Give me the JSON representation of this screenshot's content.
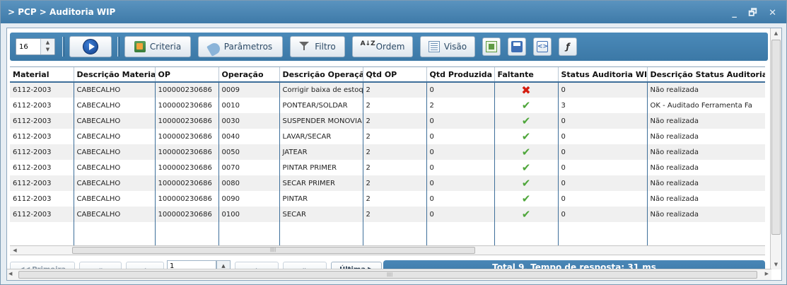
{
  "window": {
    "title": "> PCP > Auditoria WIP",
    "controls": "_ 🗗 ✕"
  },
  "toolbar": {
    "rows_per_page": "16",
    "buttons": {
      "criteria": "Criteria",
      "parametros": "Parâmetros",
      "filtro": "Filtro",
      "ordem": "Ordem",
      "visao": "Visão"
    },
    "ordem_icon_text": "A↓Z"
  },
  "table": {
    "columns": [
      "Material",
      "Descrição Material",
      "OP",
      "Operação",
      "Descrição Operação",
      "Qtd OP",
      "Qtd Produzida",
      "Faltante",
      "Status Auditoria WIP",
      "Descrição Status Auditoria"
    ],
    "rows": [
      {
        "material": "6112-2003",
        "descricao_material": "CABECALHO",
        "op": "100000230686",
        "operacao": "0009",
        "descricao_operacao": "Corrigir baixa de estoque",
        "qtd_op": "2",
        "qtd_produzida": "0",
        "faltante": "no",
        "status": "0",
        "descricao_status": "Não realizada"
      },
      {
        "material": "6112-2003",
        "descricao_material": "CABECALHO",
        "op": "100000230686",
        "operacao": "0010",
        "descricao_operacao": "PONTEAR/SOLDAR",
        "qtd_op": "2",
        "qtd_produzida": "2",
        "faltante": "yes",
        "status": "3",
        "descricao_status": "OK - Auditado Ferramenta Fa"
      },
      {
        "material": "6112-2003",
        "descricao_material": "CABECALHO",
        "op": "100000230686",
        "operacao": "0030",
        "descricao_operacao": "SUSPENDER MONOVIA",
        "qtd_op": "2",
        "qtd_produzida": "0",
        "faltante": "yes",
        "status": "0",
        "descricao_status": "Não realizada"
      },
      {
        "material": "6112-2003",
        "descricao_material": "CABECALHO",
        "op": "100000230686",
        "operacao": "0040",
        "descricao_operacao": "LAVAR/SECAR",
        "qtd_op": "2",
        "qtd_produzida": "0",
        "faltante": "yes",
        "status": "0",
        "descricao_status": "Não realizada"
      },
      {
        "material": "6112-2003",
        "descricao_material": "CABECALHO",
        "op": "100000230686",
        "operacao": "0050",
        "descricao_operacao": "JATEAR",
        "qtd_op": "2",
        "qtd_produzida": "0",
        "faltante": "yes",
        "status": "0",
        "descricao_status": "Não realizada"
      },
      {
        "material": "6112-2003",
        "descricao_material": "CABECALHO",
        "op": "100000230686",
        "operacao": "0070",
        "descricao_operacao": "PINTAR PRIMER",
        "qtd_op": "2",
        "qtd_produzida": "0",
        "faltante": "yes",
        "status": "0",
        "descricao_status": "Não realizada"
      },
      {
        "material": "6112-2003",
        "descricao_material": "CABECALHO",
        "op": "100000230686",
        "operacao": "0080",
        "descricao_operacao": "SECAR PRIMER",
        "qtd_op": "2",
        "qtd_produzida": "0",
        "faltante": "yes",
        "status": "0",
        "descricao_status": "Não realizada"
      },
      {
        "material": "6112-2003",
        "descricao_material": "CABECALHO",
        "op": "100000230686",
        "operacao": "0090",
        "descricao_operacao": "PINTAR",
        "qtd_op": "2",
        "qtd_produzida": "0",
        "faltante": "yes",
        "status": "0",
        "descricao_status": "Não realizada"
      },
      {
        "material": "6112-2003",
        "descricao_material": "CABECALHO",
        "op": "100000230686",
        "operacao": "0100",
        "descricao_operacao": "SECAR",
        "qtd_op": "2",
        "qtd_produzida": "0",
        "faltante": "yes",
        "status": "0",
        "descricao_status": "Não realizada"
      }
    ]
  },
  "pager": {
    "primeira": "Primeira",
    "ultima": "Última",
    "page": "1",
    "total_text": "Total 9, Tempo de resposta: 31 ms"
  },
  "colors": {
    "title_bar": "#4a87b7",
    "toolbar": "#4482b2",
    "check": "#4ea63a",
    "x_mark": "#d41c0e"
  },
  "icons": {
    "faltante_yes": "check-icon",
    "faltante_no": "x-mark-icon"
  }
}
